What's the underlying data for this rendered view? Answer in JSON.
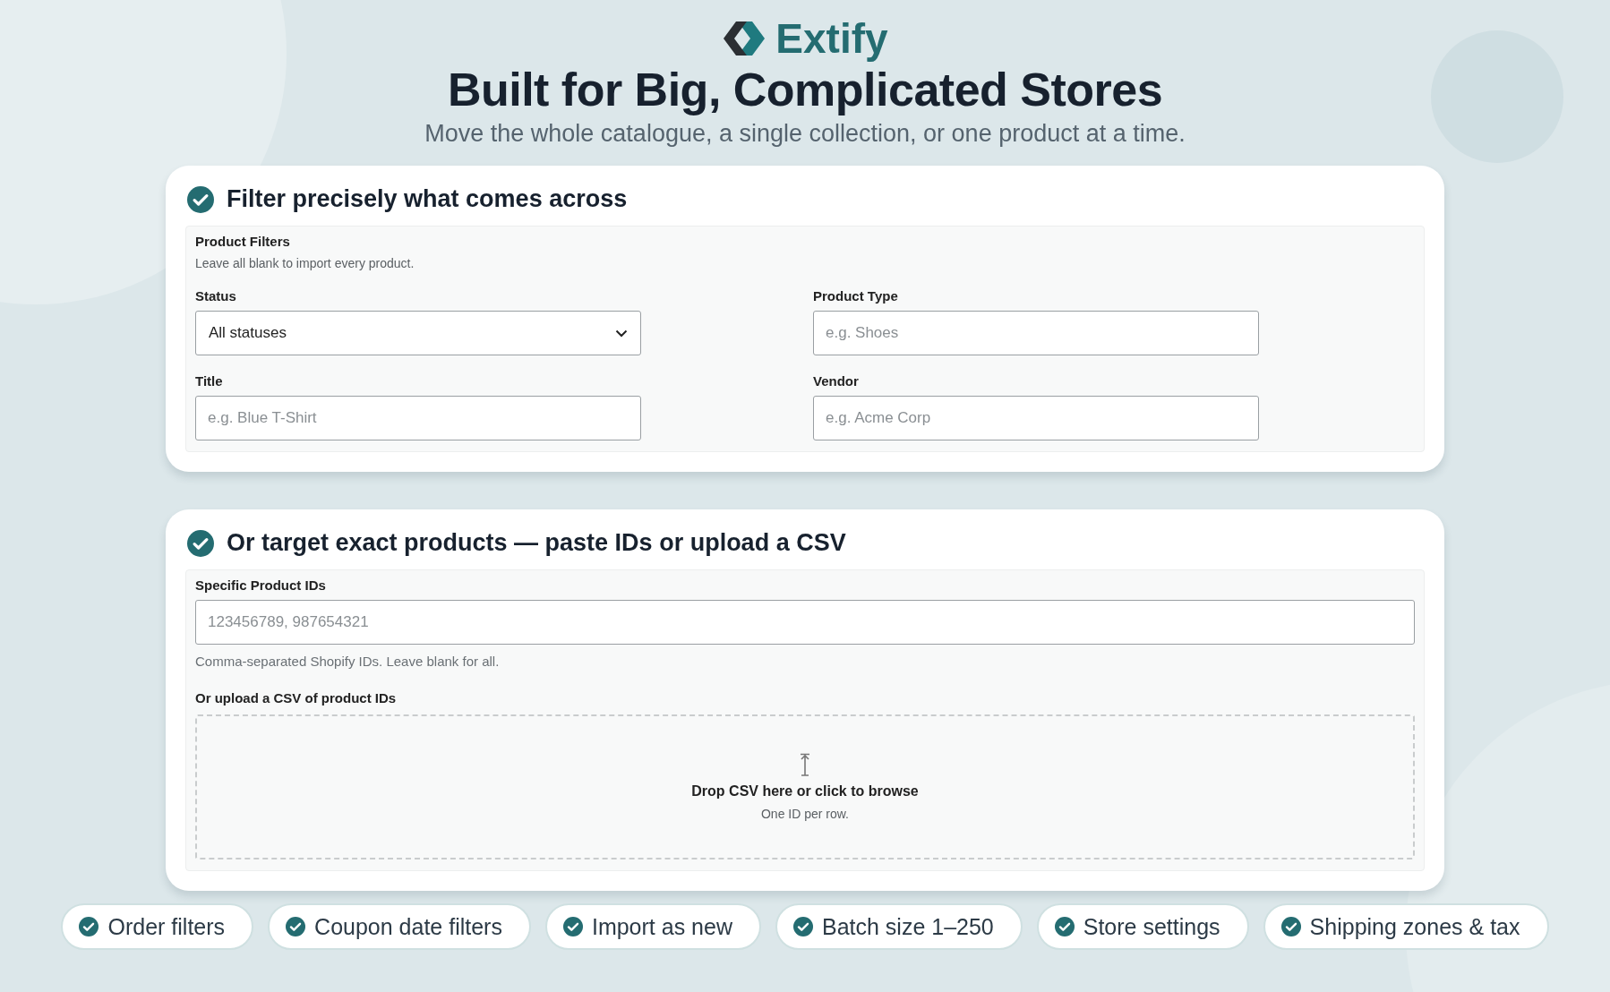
{
  "brand": {
    "name": "Extify"
  },
  "headline": "Built for Big, Complicated Stores",
  "subheadline": "Move the whole catalogue, a single collection, or one product at a time.",
  "filter_card": {
    "title": "Filter precisely what comes across",
    "panel_title": "Product Filters",
    "panel_hint": "Leave all blank to import every product.",
    "fields": [
      {
        "kind": "select",
        "label": "Status",
        "value": "All statuses"
      },
      {
        "kind": "input",
        "label": "Product Type",
        "placeholder": "e.g. Shoes"
      },
      {
        "kind": "input",
        "label": "Title",
        "placeholder": "e.g. Blue T-Shirt"
      },
      {
        "kind": "input",
        "label": "Vendor",
        "placeholder": "e.g. Acme Corp"
      }
    ]
  },
  "ids_card": {
    "title": "Or target exact products — paste IDs or upload a CSV",
    "ids_label": "Specific Product IDs",
    "ids_placeholder": "123456789, 987654321",
    "ids_hint": "Comma-separated Shopify IDs. Leave blank for all.",
    "upload_label": "Or upload a CSV of product IDs",
    "drop_title": "Drop CSV here or click to browse",
    "drop_hint": "One ID per row."
  },
  "features": [
    "Order filters",
    "Coupon date filters",
    "Import as new",
    "Batch size 1–250",
    "Store settings",
    "Shipping zones & tax"
  ]
}
